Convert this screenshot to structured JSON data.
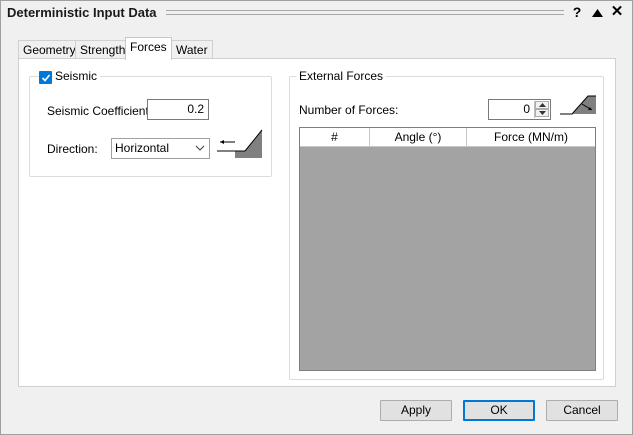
{
  "window": {
    "title": "Deterministic Input Data",
    "help_label": "?",
    "close_label": "✕"
  },
  "tabs": [
    {
      "label": "Geometry",
      "active": false
    },
    {
      "label": "Strength",
      "active": false
    },
    {
      "label": "Forces",
      "active": true
    },
    {
      "label": "Water",
      "active": false
    }
  ],
  "seismic": {
    "group_label": "Seismic",
    "checked": true,
    "coefficient_label": "Seismic Coefficient:",
    "coefficient_value": "0.2",
    "direction_label": "Direction:",
    "direction_value": "Horizontal",
    "icon": "seismic-slope-icon"
  },
  "external_forces": {
    "group_label": "External Forces",
    "count_label": "Number of Forces:",
    "count_value": "0",
    "icon": "force-slope-icon",
    "columns": [
      "#",
      "Angle (°)",
      "Force (MN/m)"
    ],
    "rows": []
  },
  "buttons": {
    "apply": "Apply",
    "ok": "OK",
    "cancel": "Cancel"
  },
  "colors": {
    "accent": "#0078d7",
    "grid_background": "#a3a3a3",
    "slope_fill": "#808080"
  }
}
